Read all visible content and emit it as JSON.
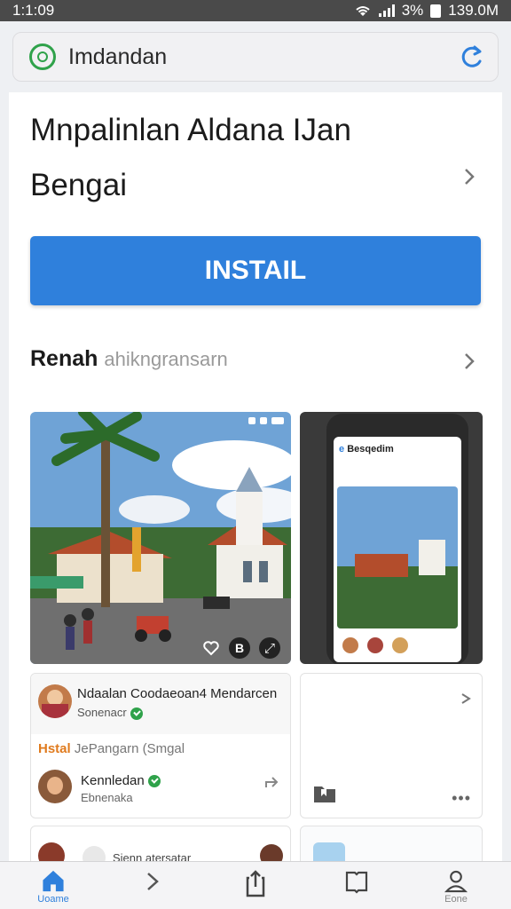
{
  "status_bar": {
    "time": "1:1:09",
    "battery": "3%",
    "clock": "139.0M"
  },
  "browser": {
    "url": "Imdandan"
  },
  "app": {
    "title_line1": "Mnpalinlan Aldana IJan",
    "title_line2": "Bengai",
    "install_label": "INSTAIL"
  },
  "section": {
    "heading": "Renah",
    "subheading": "ahikngransarn"
  },
  "screenshots": [
    {
      "phone_header": "Besqedim"
    }
  ],
  "cards": {
    "main": {
      "title": "Ndaalan Coodaeoan4 Mendarcen",
      "subtitle": "Sonenacr",
      "tag_label": "Hstal",
      "tag_text": "JePangarn (Smgal",
      "user_name": "Kennledan",
      "user_sub": "Ebnenaka"
    }
  },
  "bottom_peek": {
    "text": "Sienn atersatar"
  },
  "nav": {
    "home_label": "Uoame",
    "profile_label": "Eone"
  },
  "colors": {
    "accent": "#2f80dc",
    "verified": "#2fa24a",
    "status_bar": "#4a4a4a"
  }
}
